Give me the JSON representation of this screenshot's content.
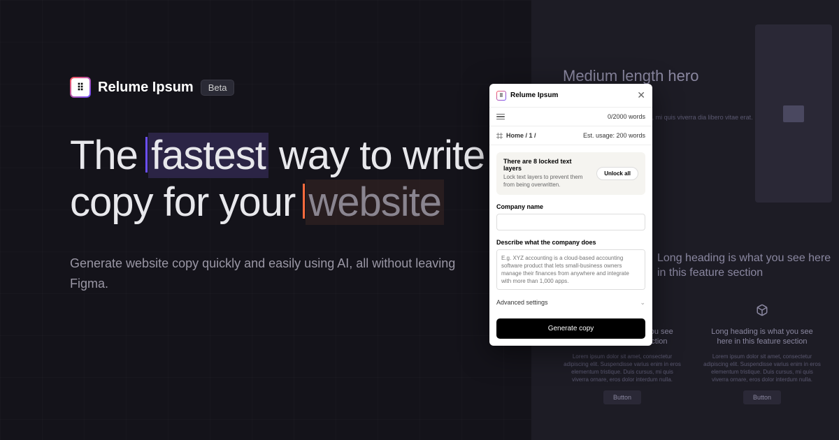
{
  "logo": {
    "text": "Relume Ipsum",
    "badge": "Beta",
    "glyph": "⠿"
  },
  "headline": {
    "part1": "The ",
    "highlight1": "fastest",
    "part2": " way to write copy for your",
    "highlight2": "website"
  },
  "subhead": "Generate website copy quickly and easily using AI, all without leaving Figma.",
  "plugin": {
    "title": "Relume Ipsum",
    "word_count": "0/2000 words",
    "breadcrumb": "Home / 1 /",
    "est_usage": "Est. usage: 200 words",
    "locked": {
      "title": "There are 8 locked text layers",
      "desc": "Lock text layers to prevent them from being overwritten.",
      "button": "Unlock all"
    },
    "company_label": "Company name",
    "describe_label": "Describe what the company does",
    "describe_placeholder": "E.g. XYZ accounting is a cloud-based accounting software product that lets small-business owners manage their finances from anywhere and integrate with more than 1,000 apps.",
    "advanced": "Advanced settings",
    "generate": "Generate copy"
  },
  "mock": {
    "hero_title": "Medium length hero\nes here",
    "hero_lorem": "piscing elit. Suspendisse cursus, mi quis viverra dia libero vitae erat.",
    "feature_section_title": "Long heading is what you see here in this feature section",
    "col_title": "Long heading is what you see here in this feature section",
    "col_lorem": "Lorem ipsum dolor sit amet, consectetur adipiscing elit. Suspendisse varius enim in eros elementum tristique. Duis cursus, mi quis viverra ornare, eros dolor interdum nulla.",
    "button": "Button",
    "col3_title": "Long head\nth",
    "col3_lorem": "Lorem ipsum do\nelit. Suspendis\ntristique. Duis c"
  }
}
